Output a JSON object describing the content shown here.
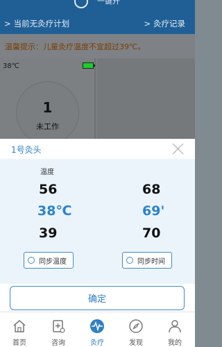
{
  "header": {
    "one_key_label": "一键开",
    "plan_status": "当前无灸疗计划",
    "records_link": "灸疗记录"
  },
  "warning": {
    "text": "温馨提示：儿童灸疗温度不宜超过39℃。"
  },
  "device_card": {
    "temperature": "38℃",
    "head_number": "1",
    "state": "未工作",
    "battery_color": "#19d02a"
  },
  "dialog": {
    "title": "1号灸头",
    "temp_heading": "温度",
    "temp_column": [
      "56",
      "38℃",
      "39"
    ],
    "time_column": [
      "68",
      "69'",
      "70"
    ],
    "sync_temp_label": "同步温度",
    "sync_time_label": "同步时间",
    "confirm_label": "确定",
    "accent_color": "#2b83cc"
  },
  "nav": {
    "items": [
      {
        "label": "首页",
        "icon": "home-icon"
      },
      {
        "label": "咨询",
        "icon": "consult-icon"
      },
      {
        "label": "灸疗",
        "icon": "moxibustion-icon",
        "active": true
      },
      {
        "label": "发现",
        "icon": "compass-icon"
      },
      {
        "label": "我的",
        "icon": "user-icon"
      }
    ]
  }
}
